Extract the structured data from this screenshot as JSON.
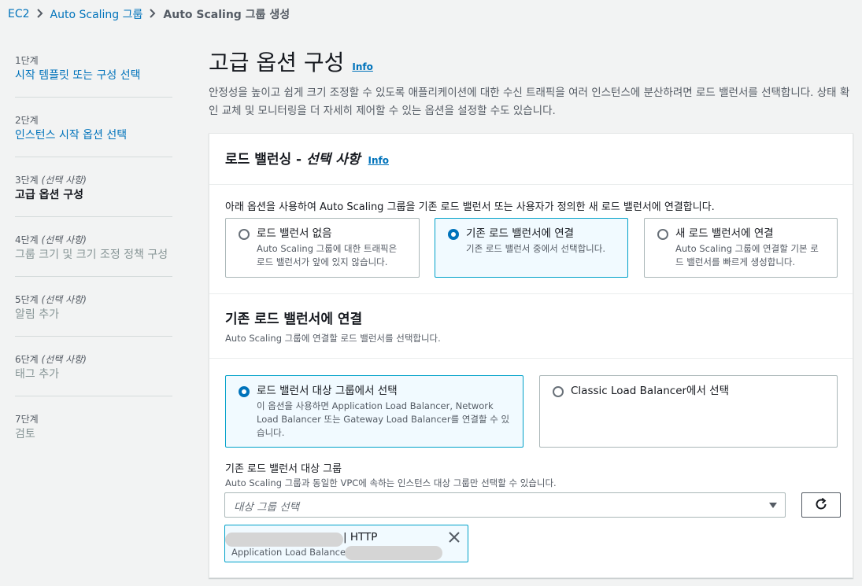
{
  "breadcrumb": {
    "items": [
      "EC2",
      "Auto Scaling 그룹"
    ],
    "current": "Auto Scaling 그룹 생성"
  },
  "steps": [
    {
      "num": "1단계",
      "optional": "",
      "title": "시작 템플릿 또는 구성 선택",
      "state": "link"
    },
    {
      "num": "2단계",
      "optional": "",
      "title": "인스턴스 시작 옵션 선택",
      "state": "link"
    },
    {
      "num": "3단계",
      "optional": "(선택 사항)",
      "title": "고급 옵션 구성",
      "state": "active"
    },
    {
      "num": "4단계",
      "optional": "(선택 사항)",
      "title": "그룹 크기 및 크기 조정 정책 구성",
      "state": "disabled"
    },
    {
      "num": "5단계",
      "optional": "(선택 사항)",
      "title": "알림 추가",
      "state": "disabled"
    },
    {
      "num": "6단계",
      "optional": "(선택 사항)",
      "title": "태그 추가",
      "state": "disabled"
    },
    {
      "num": "7단계",
      "optional": "",
      "title": "검토",
      "state": "disabled"
    }
  ],
  "page": {
    "title": "고급 옵션 구성",
    "info": "Info",
    "description": "안정성을 높이고 쉽게 크기 조정할 수 있도록 애플리케이션에 대한 수신 트래픽을 여러 인스턴스에 분산하려면 로드 밸런서를 선택합니다. 상태 확인 교체 및 모니터링을 더 자세히 제어할 수 있는 옵션을 설정할 수도 있습니다."
  },
  "lb_panel": {
    "title_main": "로드 밸런싱 - ",
    "title_em": "선택 사항",
    "info": "Info",
    "options_label": "아래 옵션을 사용하여 Auto Scaling 그룹을 기존 로드 밸런서 또는 사용자가 정의한 새 로드 밸런서에 연결합니다.",
    "options": [
      {
        "title": "로드 밸런서 없음",
        "desc": "Auto Scaling 그룹에 대한 트래픽은 로드 밸런서가 앞에 있지 않습니다.",
        "selected": false
      },
      {
        "title": "기존 로드 밸런서에 연결",
        "desc": "기존 로드 밸런서 중에서 선택합니다.",
        "selected": true
      },
      {
        "title": "새 로드 밸런서에 연결",
        "desc": "Auto Scaling 그룹에 연결할 기본 로드 밸런서를 빠르게 생성합니다.",
        "selected": false
      }
    ]
  },
  "attach": {
    "title": "기존 로드 밸런서에 연결",
    "desc": "Auto Scaling 그룹에 연결할 로드 밸런서를 선택합니다.",
    "options": [
      {
        "title": "로드 밸런서 대상 그룹에서 선택",
        "desc": "이 옵션을 사용하면 Application Load Balancer, Network Load Balancer 또는 Gateway Load Balancer를 연결할 수 있습니다.",
        "selected": true
      },
      {
        "title": "Classic Load Balancer에서 선택",
        "desc": "",
        "selected": false
      }
    ],
    "field_label": "기존 로드 밸런서 대상 그룹",
    "field_desc": "Auto Scaling 그룹과 동일한 VPC에 속하는 인스턴스 대상 그룹만 선택할 수 있습니다.",
    "select_placeholder": "대상 그룹 선택",
    "token": {
      "suffix": "| HTTP",
      "sub_label": "Application Load Balancer:"
    }
  },
  "icons": {
    "refresh": "refresh-icon",
    "close": "close-icon",
    "chevron": "chevron-right-icon",
    "caret": "caret-down-icon"
  },
  "colors": {
    "link": "#0073bb",
    "selected_border": "#00a1c9",
    "selected_bg": "#f1faff"
  }
}
